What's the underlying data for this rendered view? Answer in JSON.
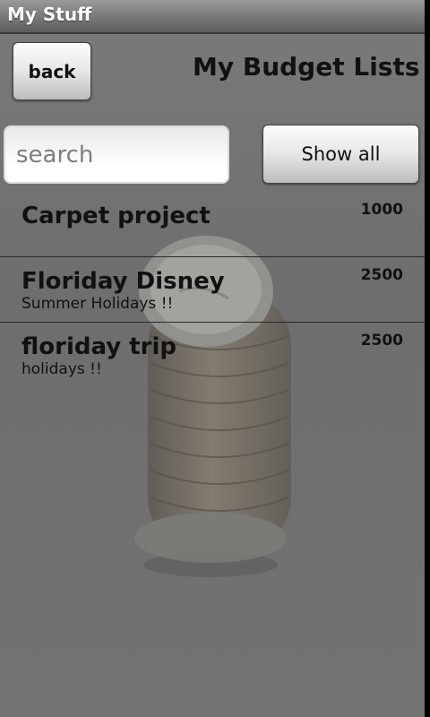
{
  "app": {
    "title": "My Stuff"
  },
  "header": {
    "back_label": "back",
    "page_title": "My Budget Lists"
  },
  "search": {
    "placeholder": "search",
    "value": "",
    "show_all_label": "Show all"
  },
  "lists": [
    {
      "name": "Carpet project",
      "description": "",
      "amount": "1000"
    },
    {
      "name": "Floriday Disney",
      "description": "Summer Holidays !!",
      "amount": "2500"
    },
    {
      "name": "floriday trip",
      "description": "holidays !!",
      "amount": "2500"
    }
  ],
  "background_image": {
    "subject": "stack of coins"
  }
}
